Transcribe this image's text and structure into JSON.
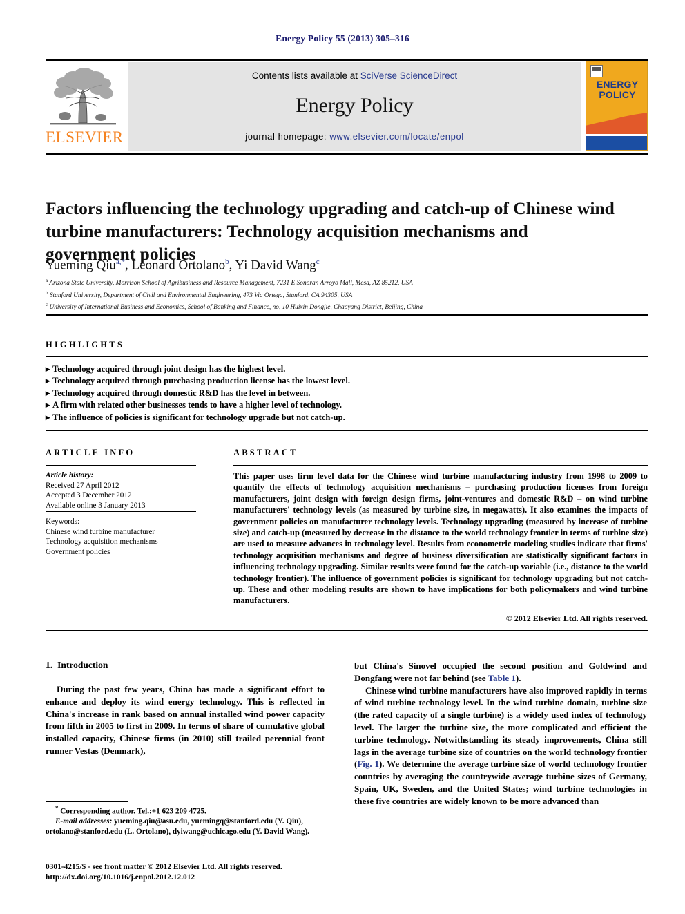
{
  "running_head": "Energy Policy 55 (2013) 305–316",
  "masthead": {
    "contents_prefix": "Contents lists available at ",
    "contents_link": "SciVerse ScienceDirect",
    "journal_name": "Energy Policy",
    "homepage_prefix": "journal homepage: ",
    "homepage_link": "www.elsevier.com/locate/enpol",
    "publisher_wordmark": "ELSEVIER",
    "cover_title_line1": "ENERGY",
    "cover_title_line2": "POLICY",
    "link_color": "#2a3b8f",
    "elsevier_orange": "#f58220",
    "cover_background": "#f0a81e",
    "cover_band_red": "#e2592a",
    "cover_band_blue": "#1b4ea3"
  },
  "article": {
    "title": "Factors influencing the technology upgrading and catch-up of Chinese wind turbine manufacturers: Technology acquisition mechanisms and government policies",
    "authors": [
      {
        "name": "Yueming Qiu",
        "marks": "a,*"
      },
      {
        "name": "Leonard Ortolano",
        "marks": "b"
      },
      {
        "name": "Yi David Wang",
        "marks": "c"
      }
    ],
    "affiliations": [
      {
        "mark": "a",
        "text": "Arizona State University, Morrison School of Agribusiness and Resource Management, 7231 E Sonoran Arroyo Mall, Mesa, AZ 85212, USA"
      },
      {
        "mark": "b",
        "text": "Stanford University, Department of Civil and Environmental Engineering, 473 Via Ortega, Stanford, CA 94305, USA"
      },
      {
        "mark": "c",
        "text": "University of International Business and Economics, School of Banking and Finance, no, 10 Huixin Dongjie, Chaoyang District, Beijing, China"
      }
    ]
  },
  "highlights": {
    "label": "HIGHLIGHTS",
    "bullet": "▸",
    "items": [
      "Technology acquired through joint design has the highest level.",
      "Technology acquired through purchasing production license has the lowest level.",
      "Technology acquired through domestic R&D has the level in between.",
      "A firm with related other businesses tends to have a higher level of technology.",
      "The influence of policies is significant for technology upgrade but not catch-up."
    ]
  },
  "article_info": {
    "label": "ARTICLE INFO",
    "history_heading": "Article history:",
    "history": [
      "Received 27 April 2012",
      "Accepted 3 December 2012",
      "Available online 3 January 2013"
    ],
    "keywords_heading": "Keywords:",
    "keywords": [
      "Chinese wind turbine manufacturer",
      "Technology acquisition mechanisms",
      "Government policies"
    ]
  },
  "abstract": {
    "label": "ABSTRACT",
    "text": "This paper uses firm level data for the Chinese wind turbine manufacturing industry from 1998 to 2009 to quantify the effects of technology acquisition mechanisms – purchasing production licenses from foreign manufacturers, joint design with foreign design firms, joint-ventures and domestic R&D – on wind turbine manufacturers' technology levels (as measured by turbine size, in megawatts). It also examines the impacts of government policies on manufacturer technology levels. Technology upgrading (measured by increase of turbine size) and catch-up (measured by decrease in the distance to the world technology frontier in terms of turbine size) are used to measure advances in technology level. Results from econometric modeling studies indicate that firms' technology acquisition mechanisms and degree of business diversification are statistically significant factors in influencing technology upgrading. Similar results were found for the catch-up variable (i.e., distance to the world technology frontier). The influence of government policies is significant for technology upgrading but not catch-up. These and other modeling results are shown to have implications for both policymakers and wind turbine manufacturers.",
    "copyright": "© 2012 Elsevier Ltd. All rights reserved."
  },
  "body": {
    "section_number": "1.",
    "section_title": "Introduction",
    "left_paragraph": "During the past few years, China has made a significant effort to enhance and deploy its wind energy technology. This is reflected in China's increase in rank based on annual installed wind power capacity from fifth in 2005 to first in 2009. In terms of share of cumulative global installed capacity, Chinese firms (in 2010) still trailed perennial front runner Vestas (Denmark),",
    "right_paragraph_1_pre": "but China's Sinovel occupied the second position and Goldwind and Dongfang were not far behind (see ",
    "right_paragraph_1_link": "Table 1",
    "right_paragraph_1_post": ").",
    "right_paragraph_2_pre": "Chinese wind turbine manufacturers have also improved rapidly in terms of wind turbine technology level. In the wind turbine domain, turbine size (the rated capacity of a single turbine) is a widely used index of technology level. The larger the turbine size, the more complicated and efficient the turbine technology. Notwithstanding its steady improvements, China still lags in the average turbine size of countries on the world technology frontier (",
    "right_paragraph_2_link": "Fig. 1",
    "right_paragraph_2_post": "). We determine the average turbine size of world technology frontier countries by averaging the countrywide average turbine sizes of Germany, Spain, UK, Sweden, and the United States; wind turbine technologies in these five countries are widely known to be more advanced than"
  },
  "footnote": {
    "corresponding": "Corresponding author. Tel.:+1 623 209 4725.",
    "email_label": "E-mail addresses:",
    "emails": "yueming.qiu@asu.edu, yuemingq@stanford.edu (Y. Qiu), ortolano@stanford.edu (L. Ortolano), dyiwang@uchicago.edu (Y. David Wang)."
  },
  "imprint": {
    "line1": "0301-4215/$ - see front matter © 2012 Elsevier Ltd. All rights reserved.",
    "line2": "http://dx.doi.org/10.1016/j.enpol.2012.12.012"
  }
}
